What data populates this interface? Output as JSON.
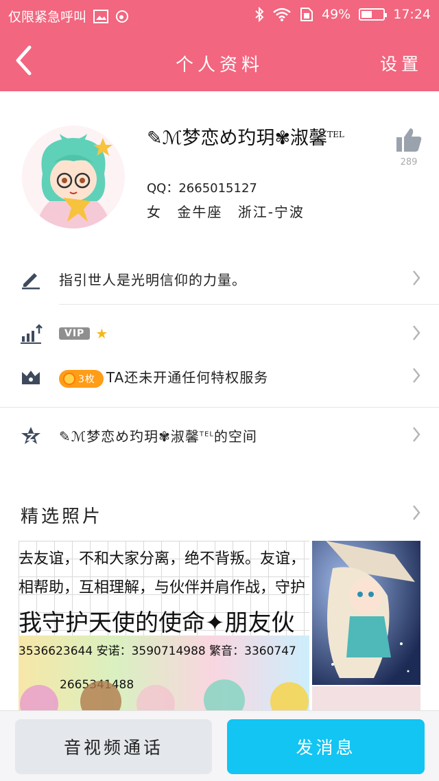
{
  "status_bar": {
    "carrier": "仅限紧急呼叫",
    "battery_percent": "49%",
    "battery_level": 0.49,
    "time": "17:24"
  },
  "header": {
    "title": "个人资料",
    "settings_label": "设置"
  },
  "profile": {
    "nickname": "✎ℳ梦恋め玓玥✾淑馨",
    "nickname_sup": "TEL",
    "qq": "QQ：2665015127",
    "info": "女 金牛座 浙江-宁波",
    "like_count": "289"
  },
  "rows": {
    "signature": "指引世人是光明信仰的力量。",
    "vip_badge": "VIP",
    "vip_star": "★",
    "coin_badge": "3枚",
    "privilege_text": "TA还未开通任何特权服务",
    "space_text": "✎ℳ梦恋め玓玥✾淑馨",
    "space_sup": "TEL",
    "space_suffix": "的空间"
  },
  "photos": {
    "title": "精选照片",
    "photo1_lines": [
      "去友谊，不和大家分离，绝不背叛。友谊，",
      "相帮助，互相理解，与伙伴并肩作战，守护",
      "我守护天使的使命✦朋友伙",
      "3536623644 安诺：3590714988 繁音：3360747",
      "2665341488"
    ]
  },
  "bottom": {
    "call_label": "音视频通话",
    "message_label": "发消息"
  },
  "colors": {
    "header_pink": "#f2667f",
    "message_blue": "#12c5f2",
    "coin_orange": "#ff9c18"
  }
}
